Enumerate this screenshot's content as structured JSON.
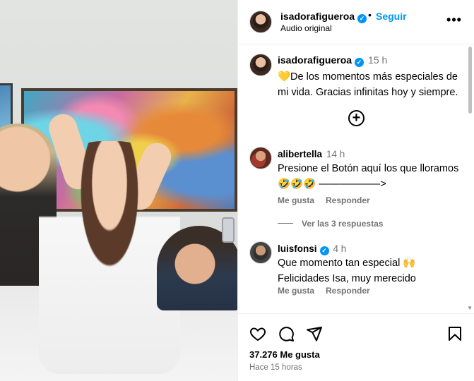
{
  "post": {
    "username": "isadorafigueroa",
    "follow_label": "Seguir",
    "audio_label": "Audio original",
    "more_label": "•••",
    "caption": {
      "username": "isadorafigueroa",
      "time": "15 h",
      "text": "💛De los momentos más especiales de mi vida. Gracias infinitas hoy y siempre."
    },
    "load_more_icon": "plus-circle-icon",
    "comments": [
      {
        "username": "alibertella",
        "time": "14 h",
        "text": "Presione el Botón aquí los que lloramos 🤣🤣🤣 ——————>",
        "like_label": "Me gusta",
        "reply_label": "Responder",
        "view_replies_label": "Ver las 3 respuestas"
      },
      {
        "username": "luisfonsi",
        "verified": true,
        "time": "4 h",
        "text": "Que momento tan especial 🙌 Felicidades Isa, muy merecido",
        "like_label": "Me gusta",
        "reply_label": "Responder"
      }
    ],
    "likes": "37.276 Me gusta",
    "time_ago": "Hace 15 horas",
    "icons": [
      "heart-icon",
      "comment-icon",
      "share-icon",
      "bookmark-icon"
    ],
    "accent": "#0095f6"
  }
}
